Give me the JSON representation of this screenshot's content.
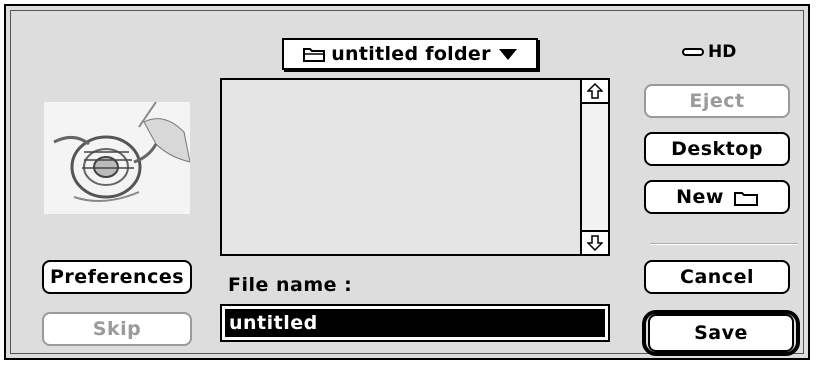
{
  "dialog": {
    "folder_popup": {
      "label": "untitled folder",
      "icon": "folder-icon"
    },
    "volume": {
      "icon": "hard-disk-icon",
      "label": "HD"
    },
    "preview": {
      "image": "french-horn-thumbnail"
    },
    "file_list": {
      "items": []
    },
    "buttons": {
      "eject": "Eject",
      "desktop": "Desktop",
      "new": "New",
      "cancel": "Cancel",
      "save": "Save",
      "preferences": "Preferences",
      "skip": "Skip"
    },
    "file_name": {
      "label": "File name :",
      "value": "untitled"
    }
  },
  "colors": {
    "dialog_bg": "#dddddd",
    "disabled": "#9a9a9a",
    "selection": "#000000"
  }
}
